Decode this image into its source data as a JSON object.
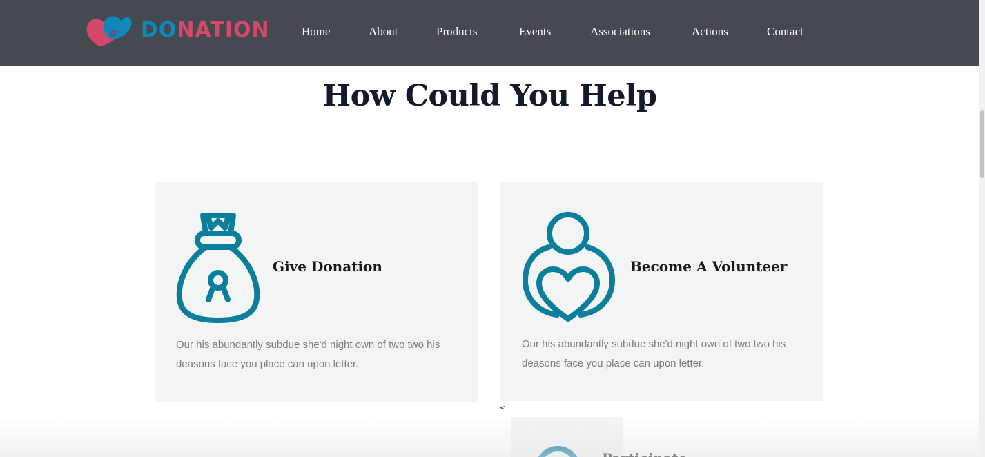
{
  "header": {
    "logo": {
      "part1": "DO",
      "part2": "NATION"
    },
    "nav": [
      "Home",
      "About",
      "Products",
      "Events",
      "Associations",
      "Actions",
      "Contact"
    ]
  },
  "section": {
    "title": "How Could You Help"
  },
  "cards": [
    {
      "title": "Give Donation",
      "icon": "money-bag-ribbon-icon",
      "text_line1": "Our his abundantly subdue she'd night own of two two his",
      "text_line2": "deasons face you place can upon letter."
    },
    {
      "title": "Become A Volunteer",
      "icon": "person-heart-icon",
      "text_line1": "Our his abundantly subdue she'd night own of two two his",
      "text_line2": "deasons face you place can upon letter."
    },
    {
      "title": "Participate",
      "icon": "participate-icon"
    }
  ],
  "misc": {
    "caret": "<"
  },
  "colors": {
    "header_bg": "#454950",
    "accent_teal": "#0b7e9c",
    "logo_blue": "#0f89b8",
    "logo_pink": "#d5486a",
    "card_bg": "#f3f4f4",
    "title": "#141a2c"
  }
}
